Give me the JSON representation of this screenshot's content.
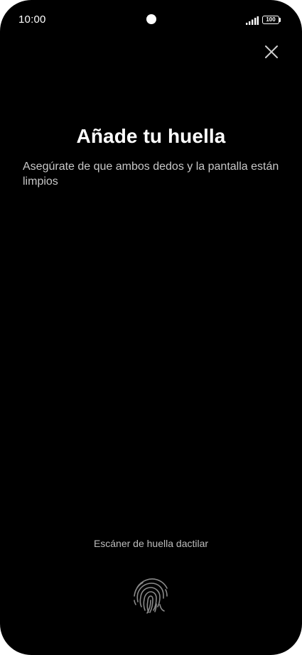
{
  "status_bar": {
    "time": "10:00",
    "battery_level": "100",
    "icons": [
      "signal-icon",
      "battery-icon"
    ]
  },
  "header": {
    "close_icon": "close-icon"
  },
  "main": {
    "title": "Añade tu huella",
    "subtitle": "Asegúrate de que ambos dedos y la pantalla están limpios"
  },
  "scanner": {
    "label": "Escáner de huella dactilar",
    "icon": "fingerprint-icon"
  },
  "colors": {
    "background": "#000000",
    "text_primary": "#ffffff",
    "text_secondary": "#c8c8c8"
  }
}
